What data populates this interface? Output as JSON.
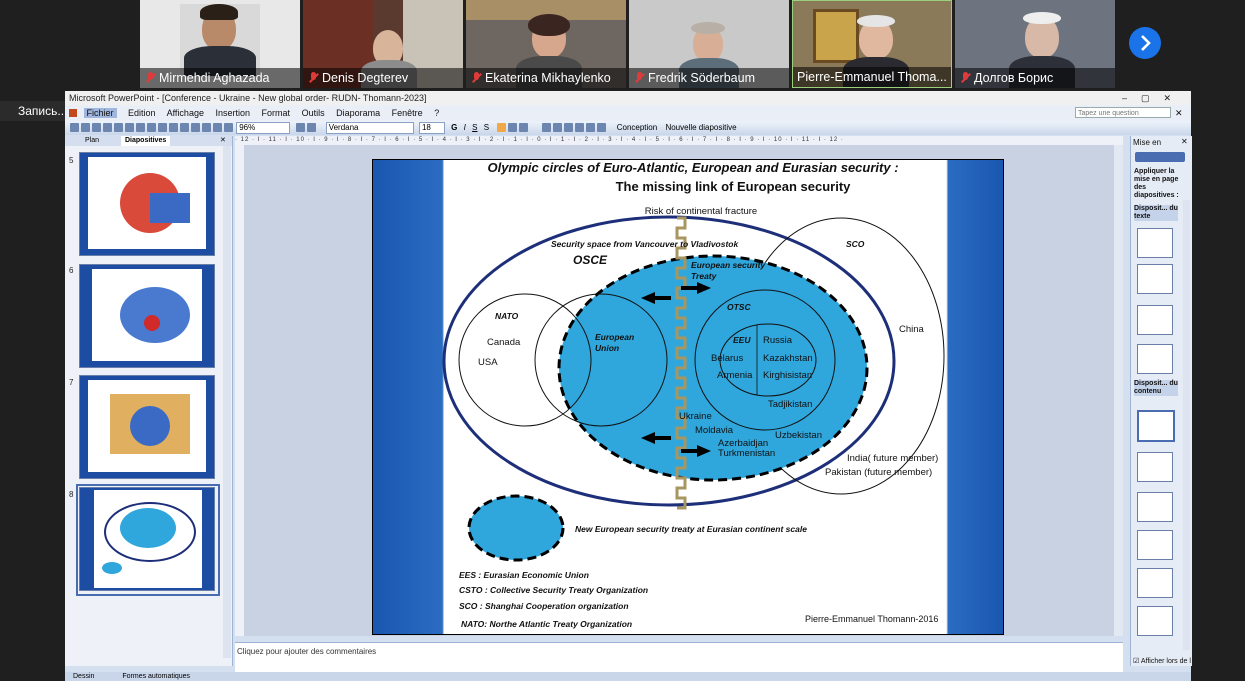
{
  "participants": [
    {
      "name": "Mirmehdi Aghazada"
    },
    {
      "name": "Denis Degterev"
    },
    {
      "name": "Ekaterina Mikhaylenko"
    },
    {
      "name": "Fredrik Söderbaum"
    },
    {
      "name": "Pierre-Emmanuel Thoma..."
    },
    {
      "name": "Долгов Борис"
    }
  ],
  "recording_label": "Запись...",
  "ppt": {
    "window_title": "Microsoft PowerPoint - [Conference - Ukraine - New global order- RUDN- Thomann-2023]",
    "menu": [
      "Fichier",
      "Edition",
      "Affichage",
      "Insertion",
      "Format",
      "Outils",
      "Diaporama",
      "Fenêtre",
      "?"
    ],
    "help_placeholder": "Tapez une question",
    "zoom": "96%",
    "font": "Verdana",
    "font_size": "18",
    "design_label": "Conception",
    "new_slide_label": "Nouvelle diapositive",
    "tab_plan": "Plan",
    "tab_slides": "Diapositives",
    "slide_numbers": [
      "5",
      "6",
      "7",
      "8"
    ],
    "notes_placeholder": "Cliquez pour ajouter des commentaires",
    "right_pane": {
      "title": "Mise en",
      "apply": "Appliquer la mise en page des diapositives :",
      "section_text": "Disposit... du texte",
      "section_content": "Disposit... du contenu",
      "show_check": "Afficher lors de l"
    },
    "bottom": {
      "draw": "Dessin",
      "autoshapes": "Formes automatiques"
    }
  },
  "slide": {
    "title1": "Olympic circles of  Euro-Atlantic, European and Eurasian security :",
    "title2": "The missing link of European security",
    "risk": "Risk of continental fracture",
    "security_space": "Security space from Vancouver to Vladivostok",
    "osce": "OSCE",
    "sco": "SCO",
    "est1": "European security",
    "est2": "Treaty",
    "nato": "NATO",
    "canada": "Canada",
    "usa": "USA",
    "eu1": "European",
    "eu2": "Union",
    "otsc": "OTSC",
    "eeu": "EEU",
    "russia": "Russia",
    "belarus": "Belarus",
    "kazakhstan": "Kazakhstan",
    "armenia": "Armenia",
    "kirghisistan": "Kirghisistan",
    "tadjikistan": "Tadjikistan",
    "uzbekistan": "Uzbekistan",
    "china": "China",
    "ukraine": "Ukraine",
    "moldavia": "Moldavia",
    "azerbaidjan": "Azerbaidjan",
    "turkmenistan": "Turkmenistan",
    "india": "India( future member)",
    "pakistan": "Pakistan (future member)",
    "legend_treaty": "New European security treaty at Eurasian continent scale",
    "eeu_def": "EES : Eurasian Economic Union",
    "csto_def": "CSTO : Collective Security Treaty Organization",
    "sco_def": "SCO : Shanghai Cooperation organization",
    "nato_def": "NATO: Northe Atlantic Treaty Organization",
    "credit": "Pierre-Emmanuel Thomann-2016"
  },
  "colors": {
    "accent_blue": "#1a57b0",
    "treaty_fill": "#2fa6dc",
    "osce_ring": "#1e2f7a",
    "zoom_button": "#1a73e8",
    "mic_off": "#e03a3a"
  }
}
